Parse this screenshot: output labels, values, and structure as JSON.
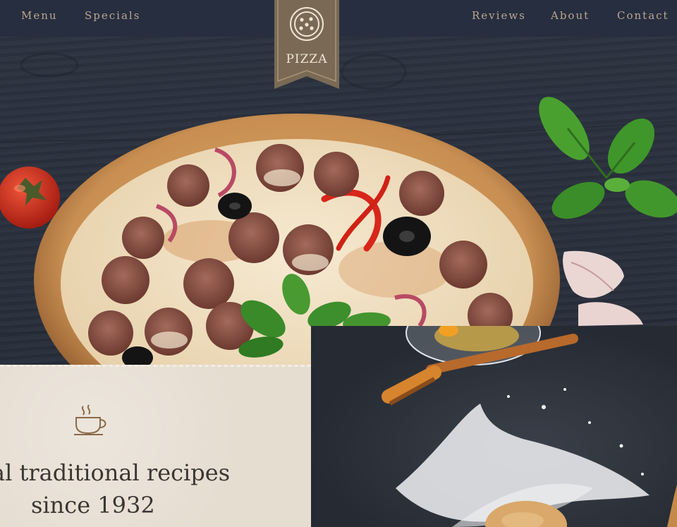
{
  "nav": {
    "left": [
      {
        "label": "Menu"
      },
      {
        "label": "Specials"
      }
    ],
    "right": [
      {
        "label": "Reviews"
      },
      {
        "label": "About"
      },
      {
        "label": "Contact"
      }
    ],
    "logo_text": "PIZZA"
  },
  "hero": {
    "card": {
      "icon": "coffee-cup-icon",
      "heading_line1": "al traditional recipes",
      "heading_line2": "since 1932"
    }
  },
  "colors": {
    "nav_bg": "#272e40",
    "nav_text": "#b9a78d",
    "ribbon": "#7a6a55",
    "card_bg": "#e6ddd1",
    "card_text": "#3a3632"
  }
}
